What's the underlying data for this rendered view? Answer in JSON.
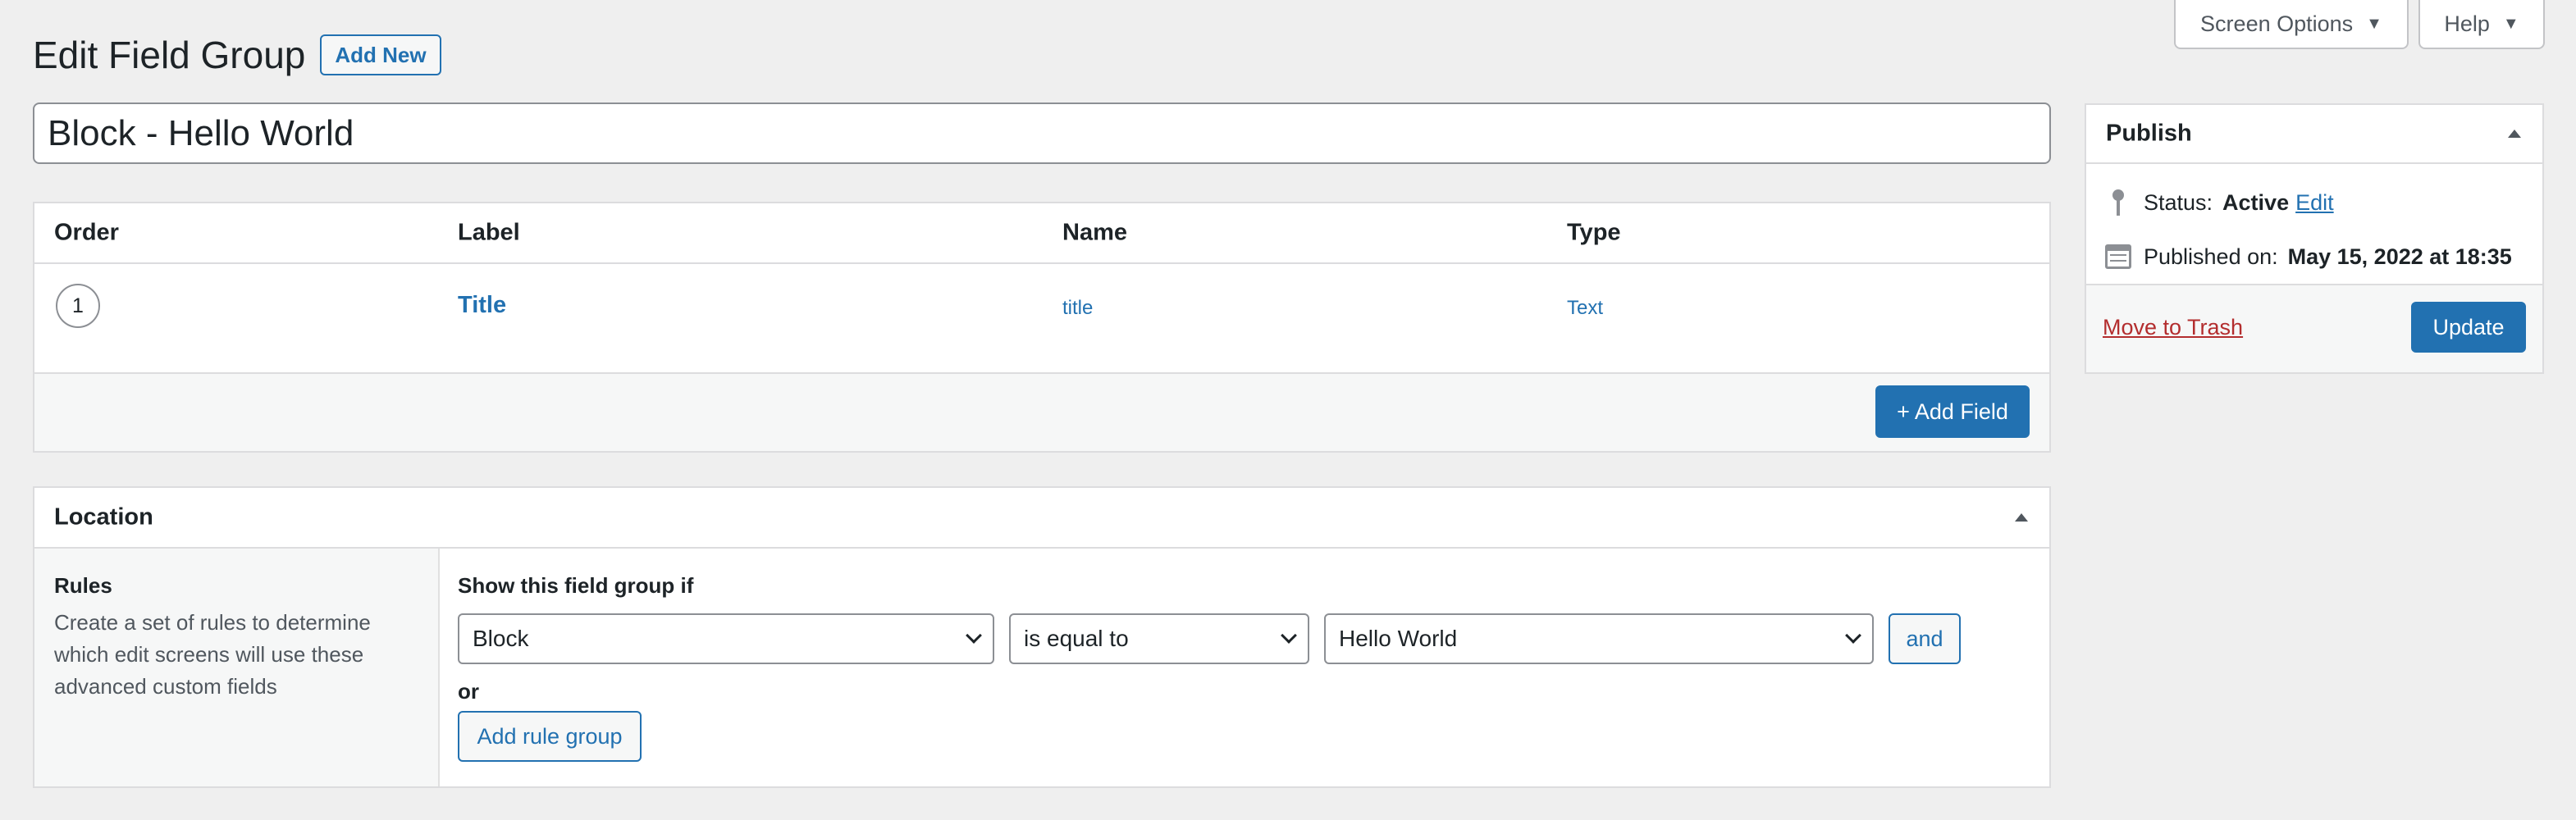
{
  "screen_meta": {
    "screen_options_label": "Screen Options",
    "help_label": "Help"
  },
  "header": {
    "title": "Edit Field Group",
    "add_new_label": "Add New"
  },
  "title_input": {
    "value": "Block - Hello World"
  },
  "fields": {
    "columns": [
      "Order",
      "Label",
      "Name",
      "Type"
    ],
    "rows": [
      {
        "order": "1",
        "label": "Title",
        "name": "title",
        "type": "Text"
      }
    ],
    "add_field_label": "+ Add Field"
  },
  "location": {
    "title": "Location",
    "rules_title": "Rules",
    "rules_description": "Create a set of rules to determine which edit screens will use these advanced custom fields",
    "show_if_label": "Show this field group if",
    "rule": {
      "param": "Block",
      "operator": "is equal to",
      "value": "Hello World",
      "and_label": "and"
    },
    "or_label": "or",
    "add_rule_group_label": "Add rule group"
  },
  "publish": {
    "title": "Publish",
    "status_label": "Status:",
    "status_value": "Active",
    "status_edit_label": "Edit",
    "published_label": "Published on:",
    "published_value": "May 15, 2022 at 18:35",
    "trash_label": "Move to Trash",
    "update_label": "Update"
  }
}
